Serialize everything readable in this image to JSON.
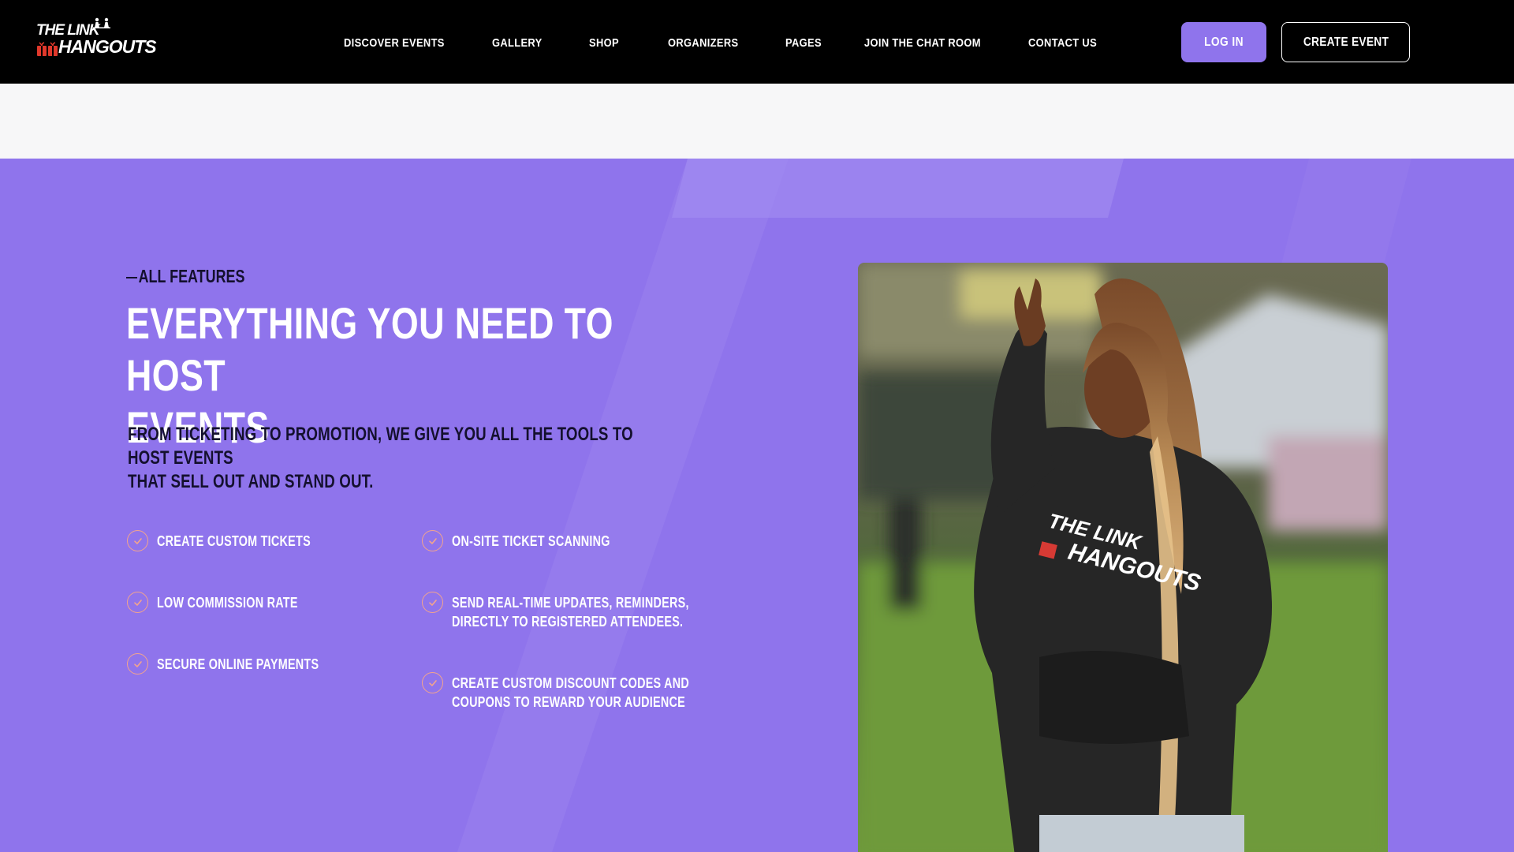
{
  "header": {
    "logo": {
      "line1": "THE LINK",
      "line2": "HANGOUTS"
    },
    "nav": [
      {
        "label": "DISCOVER EVENTS",
        "name": "nav-discover-events"
      },
      {
        "label": "GALLERY",
        "name": "nav-gallery"
      },
      {
        "label": "SHOP",
        "name": "nav-shop"
      },
      {
        "label": "ORGANIZERS",
        "name": "nav-organizers"
      },
      {
        "label": "PAGES",
        "name": "nav-pages"
      },
      {
        "label": "JOIN THE CHAT ROOM",
        "name": "nav-join-chat-room"
      },
      {
        "label": "CONTACT US",
        "name": "nav-contact-us"
      }
    ],
    "login_label": "LOG IN",
    "create_event_label": "CREATE EVENT"
  },
  "features": {
    "eyebrow": "ALL FEATURES",
    "heading_line1": "EVERYTHING YOU NEED TO HOST",
    "heading_line2": "EVENTS",
    "subtext_line1": "FROM TICKETING TO PROMOTION, WE GIVE YOU ALL THE TOOLS TO HOST EVENTS",
    "subtext_line2": "THAT SELL OUT AND STAND OUT.",
    "left_items": [
      {
        "line1": "CREATE CUSTOM TICKETS",
        "line2": ""
      },
      {
        "line1": "LOW COMMISSION RATE",
        "line2": ""
      },
      {
        "line1": "SECURE ONLINE PAYMENTS",
        "line2": ""
      }
    ],
    "right_items": [
      {
        "line1": "ON-SITE TICKET SCANNING",
        "line2": ""
      },
      {
        "line1": "SEND REAL-TIME UPDATES, REMINDERS,",
        "line2": "DIRECTLY TO REGISTERED ATTENDEES."
      },
      {
        "line1": "CREATE CUSTOM DISCOUNT CODES AND",
        "line2": "COUPONS TO REWARD YOUR AUDIENCE"
      }
    ],
    "hoodie_print": {
      "line1": "THE LINK",
      "line2": "HANGOUTS"
    }
  },
  "colors": {
    "header_bg": "#000000",
    "accent_purple": "#8f74ec",
    "check_orange": "#f3a48d",
    "dark_text": "#14102e"
  }
}
